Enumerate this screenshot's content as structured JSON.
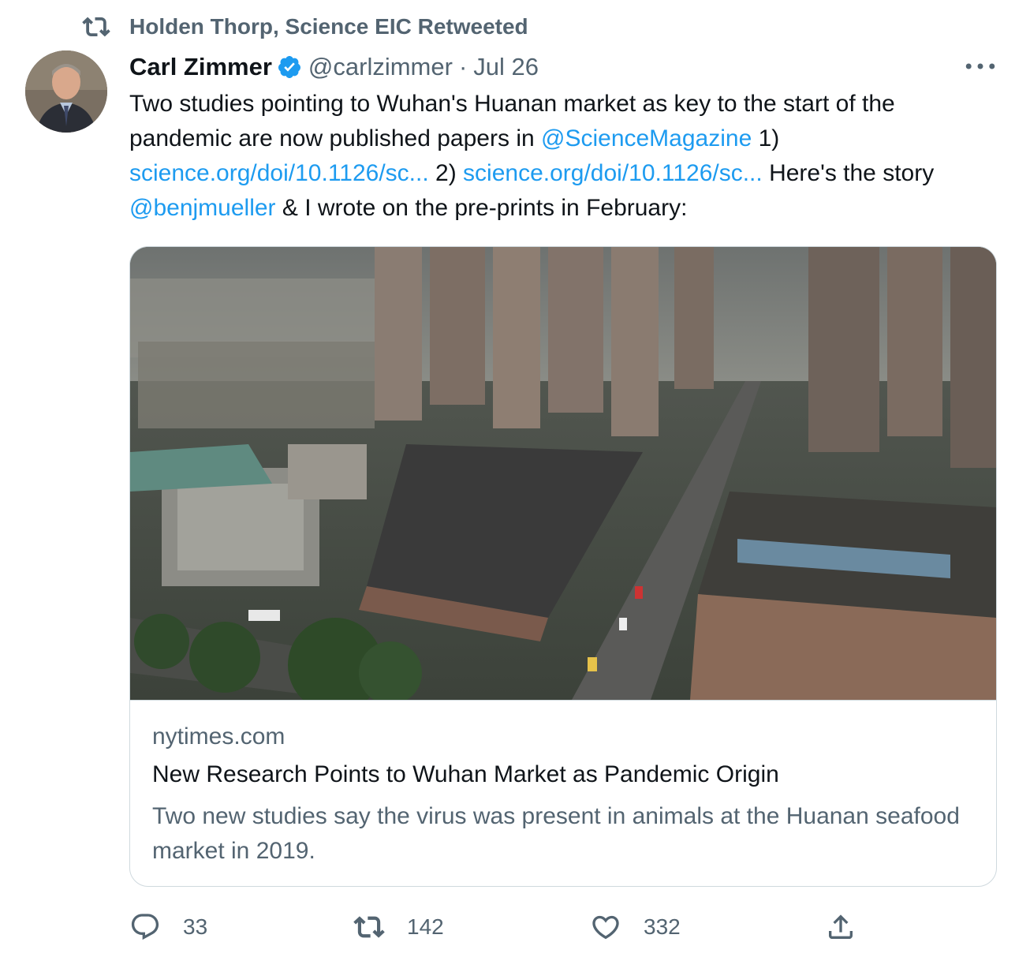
{
  "retweet_bar": {
    "text": "Holden Thorp, Science EIC Retweeted",
    "icon": "retweet-icon"
  },
  "author": {
    "name": "Carl Zimmer",
    "handle": "@carlzimmer",
    "separator": "·",
    "date": "Jul 26",
    "verified_icon": "verified-badge-icon",
    "avatar": "author-avatar"
  },
  "more_icon": "more-options-icon",
  "tweet": {
    "t1": "Two studies pointing to Wuhan's Huanan market as key to the start of the pandemic are now published papers in ",
    "m1": "@ScienceMagazine",
    "t2": " 1) ",
    "l1": "science.org/doi/10.1126/sc...",
    "t3": " 2) ",
    "l2": "science.org/doi/10.1126/sc...",
    "t4": " Here's the story ",
    "m2": "@benjmueller",
    "t5": " & I wrote on the pre-prints in February:"
  },
  "card": {
    "image": "aerial-photo-huanan-market",
    "domain": "nytimes.com",
    "title": "New Research Points to Wuhan Market as Pandemic Origin",
    "description": "Two new studies say the virus was present in animals at the Huanan seafood market in 2019."
  },
  "actions": {
    "replies": "33",
    "retweets": "142",
    "likes": "332",
    "share_icon": "share-icon"
  },
  "colors": {
    "link": "#1d9bf0",
    "secondary_text": "#536471",
    "primary_text": "#0f1419",
    "border": "#cfd9de"
  }
}
